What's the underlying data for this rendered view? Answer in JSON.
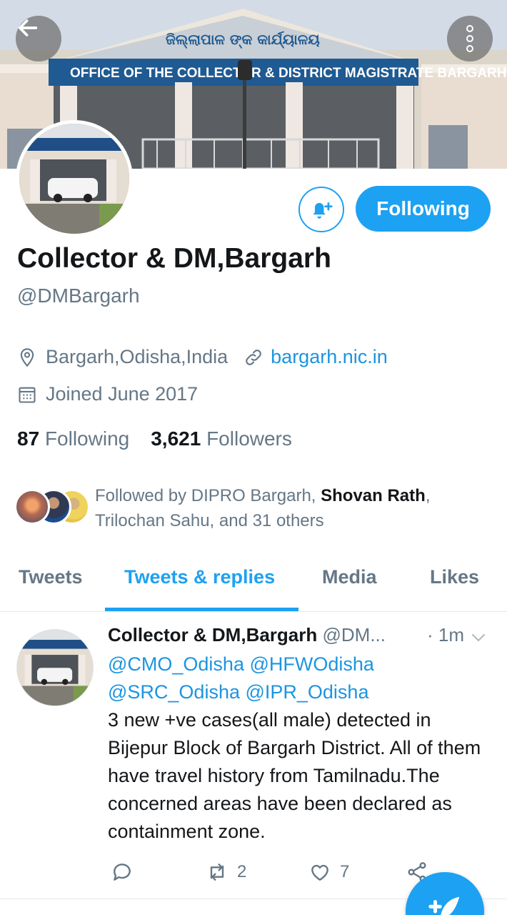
{
  "banner": {
    "building_sign": "OFFICE OF THE COLLECTOR & DISTRICT MAGISTRATE BARGARH",
    "odia_sign": "ଜିଲ୍ଲାପାଳ ଙ୍କ କାର୍ଯ୍ୟାଳୟ"
  },
  "nav": {
    "back_icon": "arrow-left-icon",
    "more_icon": "more-vertical-icon"
  },
  "profile": {
    "display_name": "Collector & DM,Bargarh",
    "handle": "@DMBargarh",
    "location": "Bargarh,Odisha,India",
    "website": "bargarh.nic.in",
    "joined": "Joined June 2017",
    "following_count": "87",
    "following_label": "Following",
    "followers_count": "3,621",
    "followers_label": "Followers"
  },
  "actions": {
    "notify_icon": "bell-plus-icon",
    "following_button": "Following"
  },
  "followed_by": {
    "prefix": "Followed by DIPRO Bargarh, ",
    "bold_name": "Shovan Rath",
    "suffix": ",",
    "line2": "Trilochan Sahu, and 31 others"
  },
  "tabs": [
    {
      "label": "Tweets"
    },
    {
      "label": "Tweets & replies"
    },
    {
      "label": "Media"
    },
    {
      "label": "Likes"
    }
  ],
  "tweet": {
    "name": "Collector & DM,Bargarh",
    "handle": "@DM...",
    "time": "· 1m",
    "mentions_line1": "@CMO_Odisha @HFWOdisha",
    "mentions_line2": "@SRC_Odisha @IPR_Odisha",
    "text": "3 new +ve cases(all male) detected in Bijepur Block of Bargarh District. All of them have travel history from Tamilnadu.The concerned areas have been declared as containment zone.",
    "reply_count": "",
    "retweet_count": "2",
    "like_count": "7"
  },
  "fab": {
    "icon": "compose-tweet-icon"
  },
  "colors": {
    "accent": "#1da1f2",
    "link": "#1b95e0",
    "muted": "#657786",
    "text": "#14171a"
  }
}
